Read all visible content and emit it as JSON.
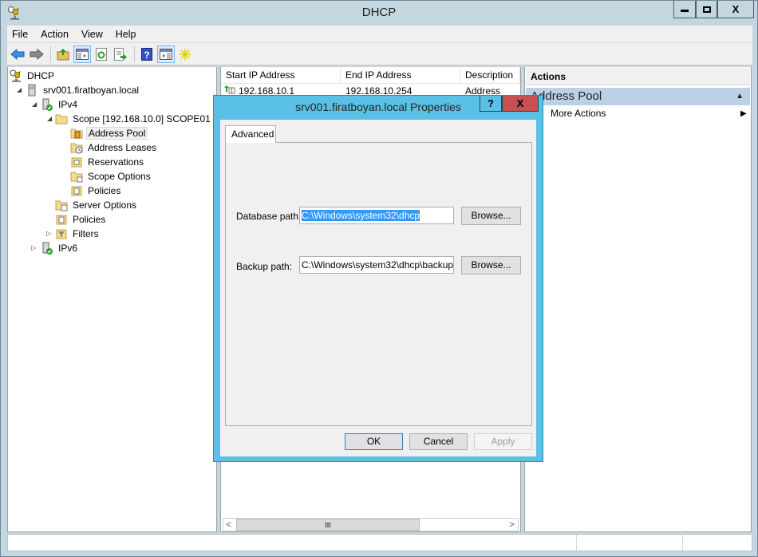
{
  "window": {
    "title": "DHCP",
    "app_icon": "dhcp-icon",
    "controls": {
      "minimize": "▬",
      "maximize": "☐",
      "close": "X"
    }
  },
  "menu": [
    "File",
    "Action",
    "View",
    "Help"
  ],
  "toolbar": [
    {
      "icon": "back-arrow-icon"
    },
    {
      "icon": "forward-arrow-icon"
    },
    {
      "icon": "up-folder-icon"
    },
    {
      "icon": "show-hide-console-tree-icon",
      "active": true
    },
    {
      "icon": "refresh-icon"
    },
    {
      "icon": "export-list-icon"
    },
    {
      "icon": "help-icon"
    },
    {
      "icon": "show-hide-action-pane-icon",
      "active": true
    },
    {
      "icon": "new-star-icon"
    }
  ],
  "tree": [
    {
      "label": "DHCP",
      "icon": "dhcp-icon",
      "level": 0
    },
    {
      "label": "srv001.firatboyan.local",
      "icon": "server-icon",
      "level": 1,
      "expanded": true
    },
    {
      "label": "IPv4",
      "icon": "ipv4-server-icon",
      "level": 2,
      "expanded": true
    },
    {
      "label": "Scope [192.168.10.0] SCOPE01",
      "icon": "folder-icon",
      "level": 3,
      "expanded": true
    },
    {
      "label": "Address Pool",
      "icon": "address-pool-icon",
      "level": 4,
      "selected": true
    },
    {
      "label": "Address Leases",
      "icon": "address-leases-icon",
      "level": 4
    },
    {
      "label": "Reservations",
      "icon": "reservations-icon",
      "level": 4
    },
    {
      "label": "Scope Options",
      "icon": "scope-options-icon",
      "level": 4
    },
    {
      "label": "Policies",
      "icon": "policies-icon",
      "level": 4
    },
    {
      "label": "Server Options",
      "icon": "server-options-icon",
      "level": 3
    },
    {
      "label": "Policies",
      "icon": "policies-icon",
      "level": 3
    },
    {
      "label": "Filters",
      "icon": "filters-icon",
      "level": 3,
      "expanded": false
    },
    {
      "label": "IPv6",
      "icon": "ipv6-server-icon",
      "level": 2,
      "expanded": false
    }
  ],
  "list": {
    "columns": [
      "Start IP Address",
      "End IP Address",
      "Description"
    ],
    "rows": [
      {
        "start": "192.168.10.1",
        "end": "192.168.10.254",
        "description": "Address rang"
      }
    ]
  },
  "actions": {
    "header": "Actions",
    "section": "Address Pool",
    "items": [
      "More Actions"
    ]
  },
  "dialog": {
    "title": "srv001.firatboyan.local Properties",
    "help_label": "?",
    "close_label": "X",
    "tab": "Advanced",
    "database_path_label": "Database path:",
    "database_path_value": "C:\\Windows\\system32\\dhcp",
    "backup_path_label": "Backup path:",
    "backup_path_value": "C:\\Windows\\system32\\dhcp\\backup",
    "browse_label": "Browse...",
    "ok_label": "OK",
    "cancel_label": "Cancel",
    "apply_label": "Apply"
  },
  "scrollbar": {
    "left": "<",
    "right": ">",
    "grip": "III"
  },
  "colors": {
    "dialog_frame": "#5bc0e6",
    "close_button": "#c75050",
    "selection": "#3399ff",
    "actions_section": "#bcd1e6"
  }
}
